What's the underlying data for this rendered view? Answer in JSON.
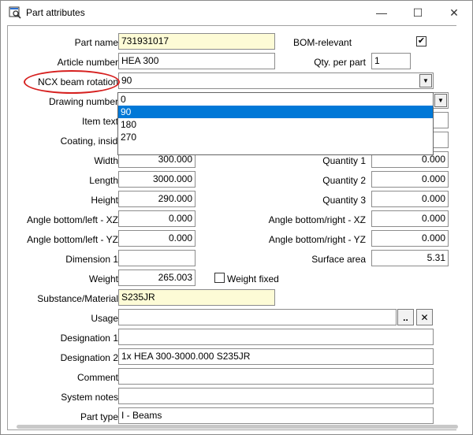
{
  "window": {
    "title": "Part attributes",
    "minimize_glyph": "—",
    "maximize_glyph": "☐",
    "close_glyph": "✕"
  },
  "form": {
    "part_name": {
      "label": "Part name",
      "value": "731931017"
    },
    "bom_relevant": {
      "label": "BOM-relevant",
      "checked": true,
      "check_glyph": "✔"
    },
    "article_number": {
      "label": "Article number",
      "value": "HEA 300"
    },
    "qty_per_part": {
      "label": "Qty. per part",
      "value": "1"
    },
    "ncx_beam_rotation": {
      "label": "NCX beam rotation",
      "value": "90",
      "options": [
        "0",
        "90",
        "180",
        "270"
      ],
      "selected_index": 1
    },
    "drawing_number": {
      "label": "Drawing number"
    },
    "item_text": {
      "label": "Item text"
    },
    "coating_inside": {
      "label": "Coating, inside"
    },
    "width": {
      "label": "Width",
      "value": "300.000"
    },
    "quantity_1": {
      "label": "Quantity 1",
      "value": "0.000"
    },
    "length": {
      "label": "Length",
      "value": "3000.000"
    },
    "quantity_2": {
      "label": "Quantity 2",
      "value": "0.000"
    },
    "height": {
      "label": "Height",
      "value": "290.000"
    },
    "quantity_3": {
      "label": "Quantity 3",
      "value": "0.000"
    },
    "angle_bottom_left_xz": {
      "label": "Angle bottom/left - XZ",
      "value": "0.000"
    },
    "angle_bottom_right_xz": {
      "label": "Angle bottom/right - XZ",
      "value": "0.000"
    },
    "angle_bottom_left_yz": {
      "label": "Angle bottom/left - YZ",
      "value": "0.000"
    },
    "angle_bottom_right_yz": {
      "label": "Angle bottom/right - YZ",
      "value": "0.000"
    },
    "dimension_1": {
      "label": "Dimension 1",
      "value": ""
    },
    "surface_area": {
      "label": "Surface area",
      "value": "5.31"
    },
    "weight": {
      "label": "Weight",
      "value": "265.003"
    },
    "weight_fixed": {
      "label": "Weight fixed",
      "checked": false
    },
    "substance_material": {
      "label": "Substance/Material",
      "value": "S235JR"
    },
    "usage": {
      "label": "Usage",
      "value": "",
      "browse_label": "..",
      "clear_label": "✕"
    },
    "designation_1": {
      "label": "Designation 1",
      "value": ""
    },
    "designation_2": {
      "label": "Designation 2",
      "value": "1x HEA 300-3000.000 S235JR"
    },
    "comment": {
      "label": "Comment",
      "value": ""
    },
    "system_notes": {
      "label": "System notes",
      "value": ""
    },
    "part_type": {
      "label": "Part type",
      "value": "I - Beams"
    }
  },
  "colors": {
    "highlight": "#d6201f",
    "selection": "#0078d7",
    "required_field_bg": "#fdfbd6"
  }
}
